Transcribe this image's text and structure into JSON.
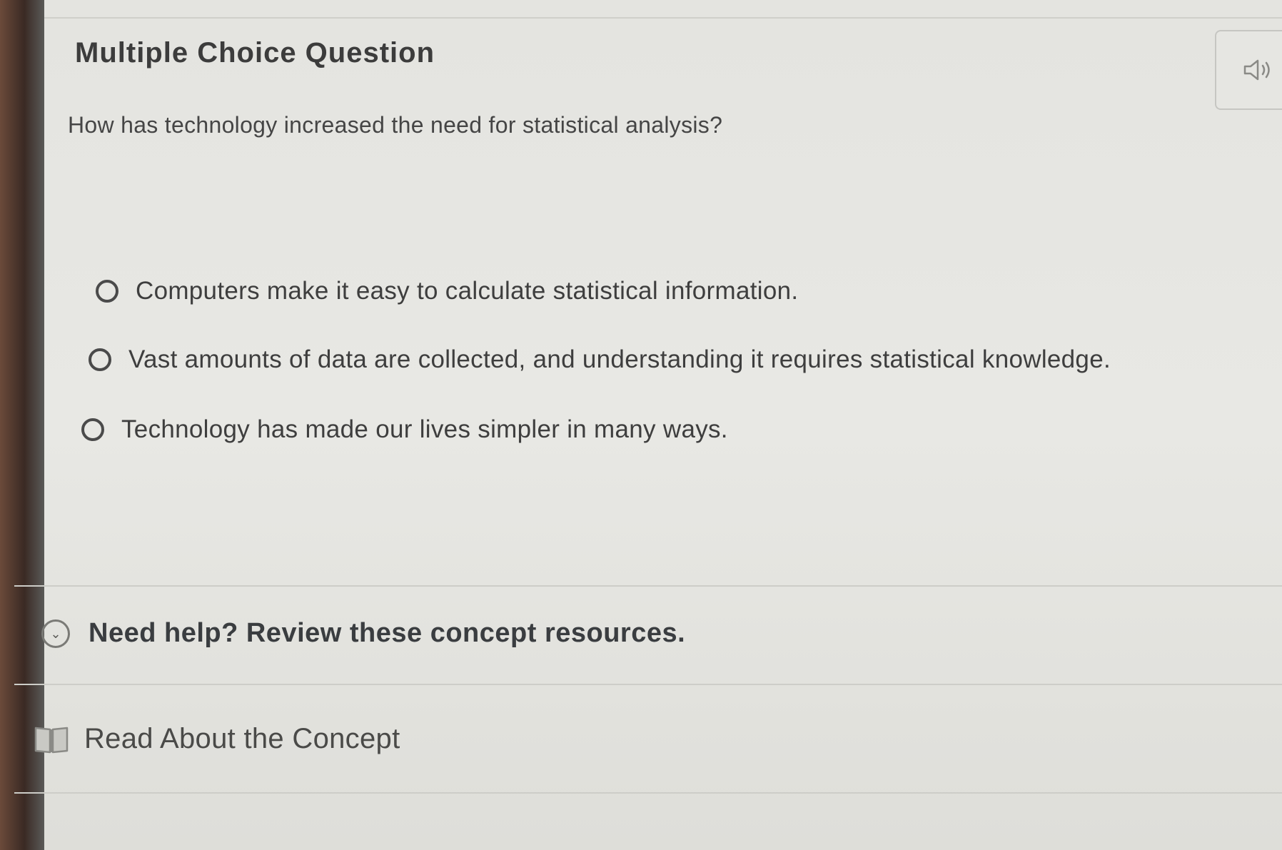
{
  "question": {
    "title": "Multiple Choice Question",
    "text": "How has technology increased the need for statistical analysis?",
    "audio_icon": "speaker-icon"
  },
  "options": [
    {
      "label": "Computers make it easy to calculate statistical information.",
      "selected": false
    },
    {
      "label": "Vast amounts of data are collected, and understanding it requires statistical knowledge.",
      "selected": false
    },
    {
      "label": "Technology has made our lives simpler in many ways.",
      "selected": false
    }
  ],
  "help": {
    "label": "Need help? Review these concept resources.",
    "icon": "chevron-down-circle-icon"
  },
  "resources": [
    {
      "label": "Read About the Concept",
      "icon": "book-icon"
    }
  ]
}
